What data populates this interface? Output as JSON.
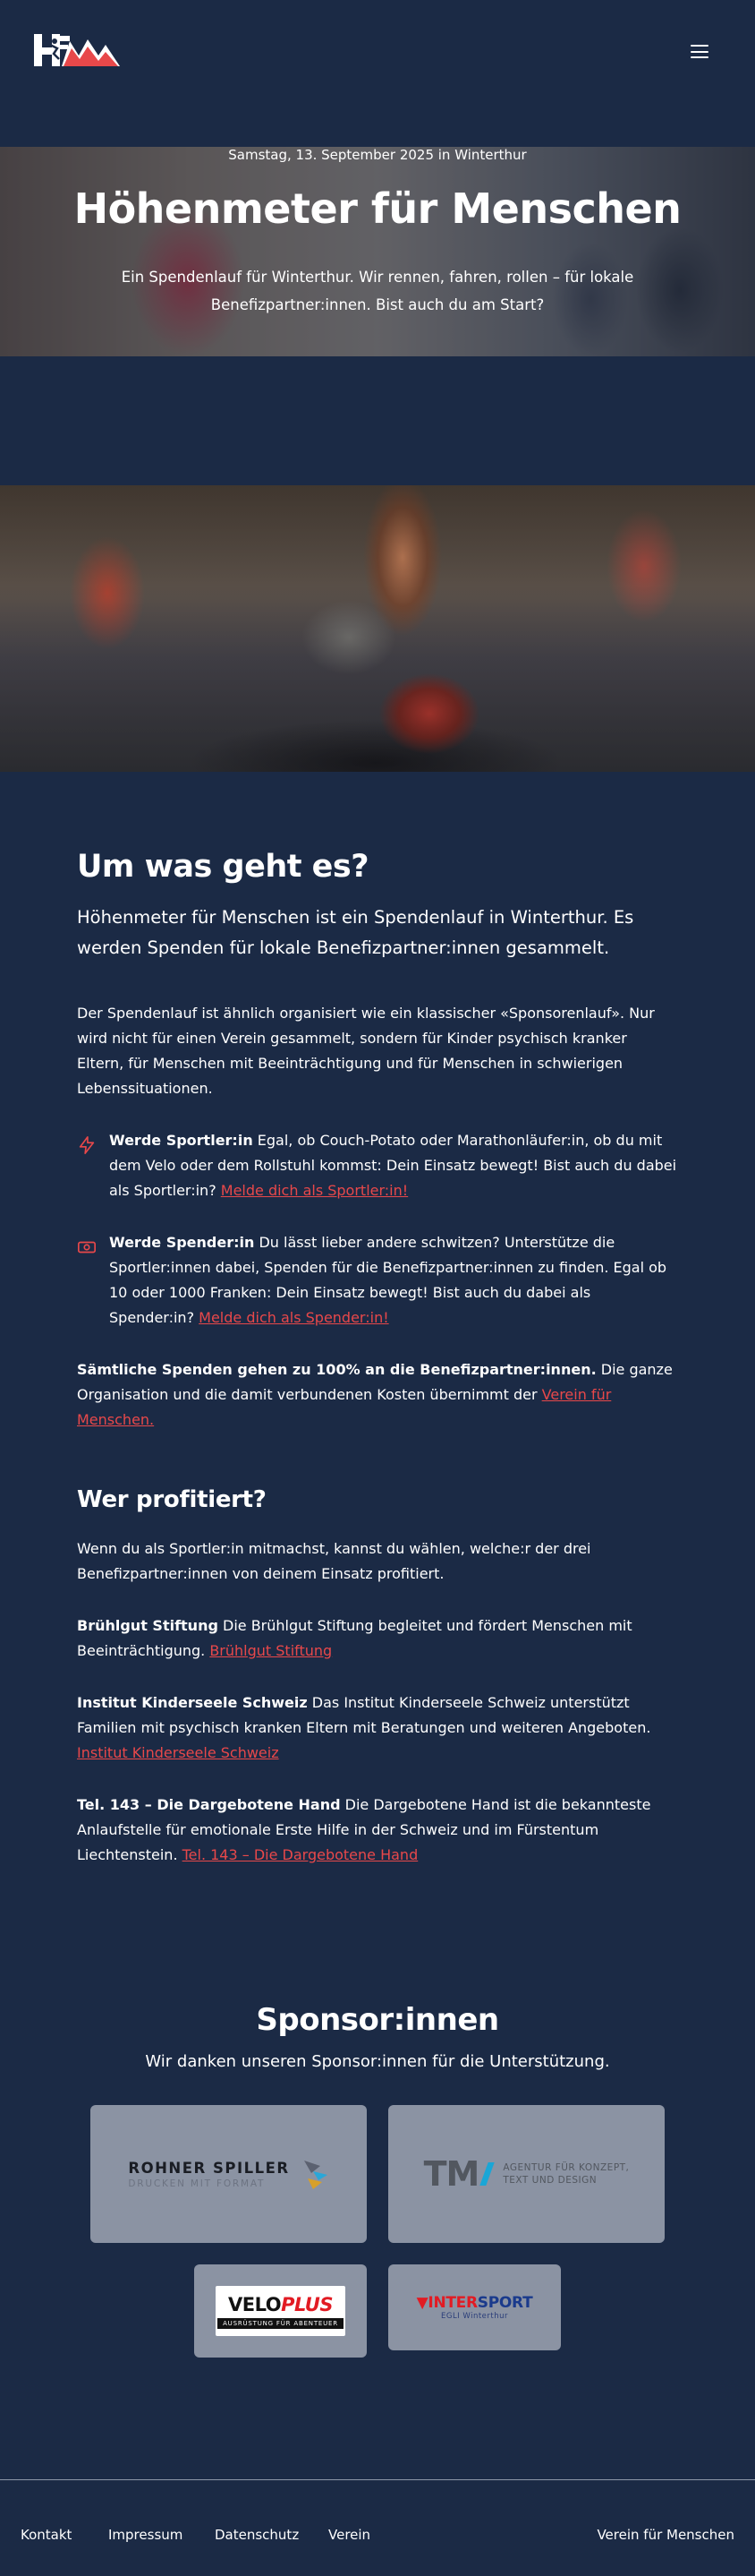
{
  "header": {
    "logo_text": "HfM",
    "menu_label": "Menü"
  },
  "hero": {
    "date_line": "Samstag, 13. September 2025 in Winterthur",
    "title": "Höhenmeter für Menschen",
    "subtitle": "Ein Spendenlauf für Winterthur. Wir rennen, fahren, rollen – für lokale Benefizpartner:innen. Bist auch du am Start?"
  },
  "about": {
    "heading": "Um was geht es?",
    "lead": "Höhenmeter für Menschen ist ein Spendenlauf in Winterthur. Es werden Spenden für lokale Benefizpartner:innen gesammelt.",
    "body": "Der Spendenlauf ist ähnlich organisiert wie ein klassischer «Sponsorenlauf». Nur wird nicht für einen Verein gesammelt, sondern für Kinder psychisch kranker Eltern, für Menschen mit Beeinträchtigung und für Menschen in schwierigen Lebenssituationen.",
    "features": [
      {
        "icon": "lightning-icon",
        "title": "Werde Sportler:in",
        "text": " Egal, ob Couch-Potato oder Marathonläufer:in, ob du mit dem Velo oder dem Rollstuhl kommst: Dein Einsatz bewegt! Bist auch du dabei als Sportler:in? ",
        "link": "Melde dich als Sportler:in!"
      },
      {
        "icon": "money-icon",
        "title": "Werde Spender:in",
        "text": " Du lässt lieber andere schwitzen? Unterstütze die Sportler:innen dabei, Spenden für die Benefizpartner:innen zu finden. Egal ob 10 oder 1000 Franken: Dein Einsatz bewegt! Bist auch du dabei als Spender:in? ",
        "link": "Melde dich als Spender:in!"
      }
    ],
    "donations_bold": "Sämtliche Spenden gehen zu 100% an die Benefizpartner:innen.",
    "donations_text": " Die ganze Organisation und die damit verbundenen Kosten übernimmt der ",
    "donations_link": "Verein für Menschen."
  },
  "beneficiaries": {
    "heading": "Wer profitiert?",
    "intro": "Wenn du als Sportler:in mitmachst, kannst du wählen, welche:r der drei Benefizpartner:innen von deinem Einsatz profitiert.",
    "partners": [
      {
        "name": "Brühlgut Stiftung",
        "text": " Die Brühlgut Stiftung begleitet und fördert Menschen mit Beeinträchtigung. ",
        "link": "Brühlgut Stiftung"
      },
      {
        "name": "Institut Kinderseele Schweiz",
        "text": " Das Institut Kinderseele Schweiz unterstützt Familien mit psychisch kranken Eltern mit Beratungen und weiteren Angeboten. ",
        "link": "Institut Kinderseele Schweiz"
      },
      {
        "name": "Tel. 143 – Die Dargebotene Hand",
        "text": " Die Dargebotene Hand ist die bekannteste Anlaufstelle für emotionale Erste Hilfe in der Schweiz und im Fürstentum Liechtenstein. ",
        "link": "Tel. 143 – Die Dargebotene Hand"
      }
    ]
  },
  "sponsors": {
    "heading": "Sponsor:innen",
    "subtitle": "Wir danken unseren Sponsor:innen für die Unterstützung.",
    "rohner": {
      "name": "ROHNER SPILLER",
      "tagline": "DRUCKEN MIT FORMAT"
    },
    "tm": {
      "mark": "TM",
      "line1": "AGENTUR FÜR KONZEPT,",
      "line2": "TEXT UND DESIGN"
    },
    "veloplus": {
      "velo": "VELO",
      "plus": "PLUS",
      "tagline": "AUSRÜSTUNG FÜR ABENTEUER"
    },
    "intersport": {
      "name_red": "INTER",
      "name_blue": "SPORT",
      "sub": "EGLI Winterthur"
    }
  },
  "footer": {
    "links": [
      "Kontakt",
      "Impressum",
      "Datenschutz",
      "Verein"
    ],
    "right_link": "Verein für Menschen"
  },
  "colors": {
    "background": "#1b2a45",
    "accent_link": "#e8484a",
    "sponsor_card": "#8b93a3"
  }
}
